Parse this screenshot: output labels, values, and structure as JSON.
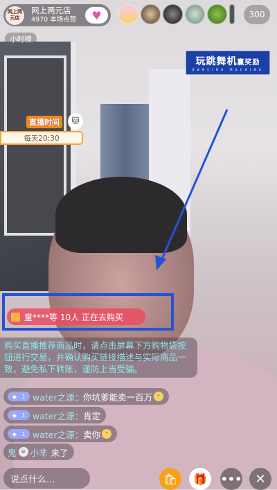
{
  "host": {
    "avatar_text": "网上两元店",
    "name": "网上两元店",
    "likes": "4970 本场点赞"
  },
  "viewer_count": "300",
  "hour_rank": "小时榜",
  "banner": {
    "title_main": "玩跳舞机",
    "title_accent": "赢奖励",
    "subtitle": "DANCING MACHINE"
  },
  "live_time": {
    "title": "直播时间",
    "time": "每天20:30"
  },
  "buying_notice": "童****等 10人 正在去购买",
  "system_notice": "购买直播推荐商品时，请点击屏幕下方购物袋按钮进行交易，并确认购买链接描述与实际商品一致，避免私下转账，谨防上当受骗。",
  "comments": [
    {
      "level": "1",
      "user": "water之源：",
      "text": "你坑爹能卖一百万",
      "emoji": "😁"
    },
    {
      "level": "1",
      "user": "water之源：",
      "text": "肯定",
      "emoji": ""
    },
    {
      "level": "1",
      "user": "water之源：",
      "text": "卖你",
      "emoji": "😁"
    }
  ],
  "join": {
    "user_pre": "鬼",
    "user_post": "小芈",
    "text": "来了"
  },
  "input_placeholder": "说点什么...",
  "colors": {
    "highlight": "#2453d6",
    "buying": "#ea4c62",
    "notice_text": "#8ee7f0"
  }
}
